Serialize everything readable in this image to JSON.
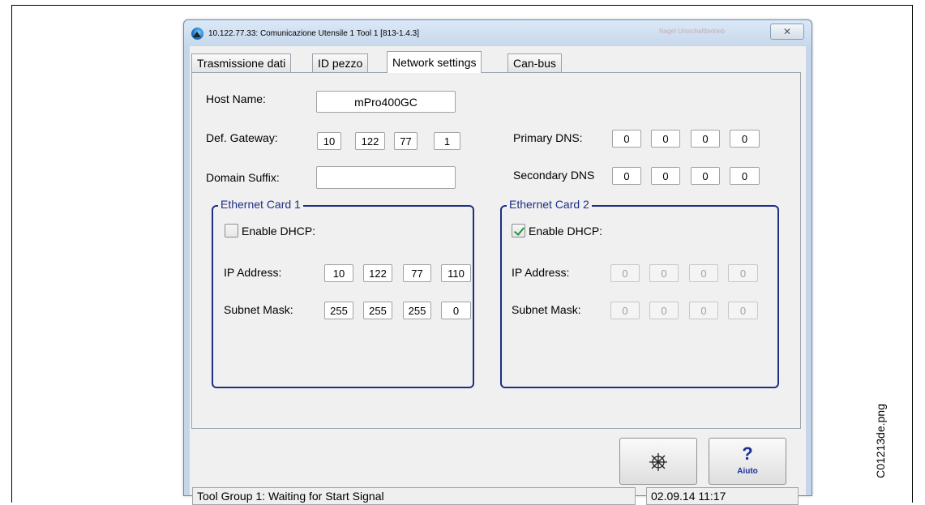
{
  "window": {
    "title": "10.122.77.33: Comunicazione  Utensile 1  Tool 1 [813-1.4.3]",
    "blurred_title": "Nagel  Umschaltbetrieb",
    "close_glyph": "✕"
  },
  "tabs": [
    "Trasmissione dati",
    "ID pezzo",
    "Network settings",
    "Can-bus"
  ],
  "active_tab": "Network settings",
  "network": {
    "host_name_label": "Host Name:",
    "host_name_value": "mPro400GC",
    "gateway_label": "Def. Gateway:",
    "gateway": [
      "10",
      "122",
      "77",
      "1"
    ],
    "domain_label": "Domain Suffix:",
    "domain_value": "",
    "primary_dns_label": "Primary DNS:",
    "primary_dns": [
      "0",
      "0",
      "0",
      "0"
    ],
    "secondary_dns_label": "Secondary DNS",
    "secondary_dns": [
      "0",
      "0",
      "0",
      "0"
    ]
  },
  "card1": {
    "title": "Ethernet Card 1",
    "dhcp_label": "Enable DHCP:",
    "dhcp_checked": false,
    "ip_label": "IP Address:",
    "ip": [
      "10",
      "122",
      "77",
      "110"
    ],
    "mask_label": "Subnet Mask:",
    "mask": [
      "255",
      "255",
      "255",
      "0"
    ]
  },
  "card2": {
    "title": "Ethernet Card 2",
    "dhcp_label": "Enable DHCP:",
    "dhcp_checked": true,
    "ip_label": "IP Address:",
    "ip": [
      "0",
      "0",
      "0",
      "0"
    ],
    "mask_label": "Subnet Mask:",
    "mask": [
      "0",
      "0",
      "0",
      "0"
    ]
  },
  "buttons": {
    "network_icon": "network-icon",
    "help_glyph": "?",
    "help_label": "Aiuto"
  },
  "status": {
    "message": "Tool Group 1: Waiting for Start Signal",
    "datetime": "02.09.14 11:17"
  },
  "side_caption": "C01213de.png",
  "colors": {
    "group_border": "#1f2f86",
    "help_icon": "#1a2f9a",
    "check": "#1a9a3a"
  }
}
